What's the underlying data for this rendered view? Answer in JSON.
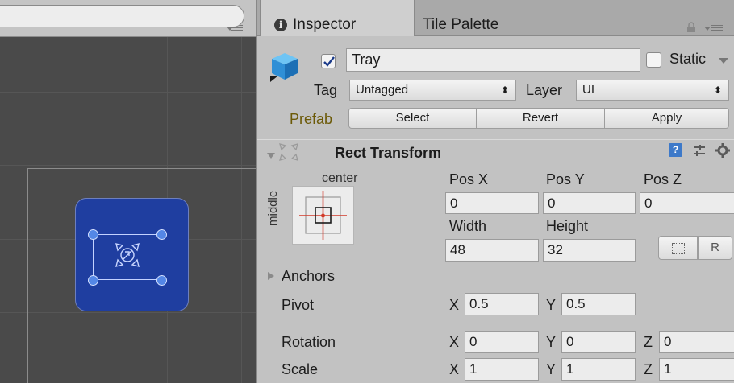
{
  "colors": {
    "scene_bg": "#4a4a4a",
    "sprite_blue": "#1f3ea0",
    "handle_blue": "#5487e6",
    "prefab_label": "#6c5a08",
    "anchor_red": "#d23a2a"
  },
  "scene": {
    "toolbar_icon": "menu-lines-icon"
  },
  "inspector": {
    "tabs": [
      {
        "label": "Inspector",
        "icon": "info-icon"
      },
      {
        "label": "Tile Palette"
      }
    ],
    "lock_icon": "lock-icon",
    "object": {
      "icon": "cube-icon",
      "active": true,
      "name": "Tray",
      "static_label": "Static",
      "static_checked": false,
      "tag_label": "Tag",
      "tag_value": "Untagged",
      "layer_label": "Layer",
      "layer_value": "UI"
    },
    "prefab": {
      "label": "Prefab",
      "buttons": [
        "Select",
        "Revert",
        "Apply"
      ]
    },
    "rect_transform": {
      "title": "Rect Transform",
      "icon": "rect-transform-icon",
      "anchor_h": "center",
      "anchor_v": "middle",
      "pos_labels": [
        "Pos X",
        "Pos Y",
        "Pos Z"
      ],
      "pos_values": [
        "0",
        "0",
        "0"
      ],
      "size_labels": [
        "Width",
        "Height"
      ],
      "size_values": [
        "48",
        "32"
      ],
      "raw_button": "R",
      "anchors_label": "Anchors",
      "pivot_label": "Pivot",
      "pivot": {
        "x_label": "X",
        "x": "0.5",
        "y_label": "Y",
        "y": "0.5"
      },
      "rotation_label": "Rotation",
      "rotation": {
        "x_label": "X",
        "x": "0",
        "y_label": "Y",
        "y": "0",
        "z_label": "Z",
        "z": "0"
      },
      "scale_label": "Scale",
      "scale": {
        "x_label": "X",
        "x": "1",
        "y_label": "Y",
        "y": "1",
        "z_label": "Z",
        "z": "1"
      }
    }
  }
}
